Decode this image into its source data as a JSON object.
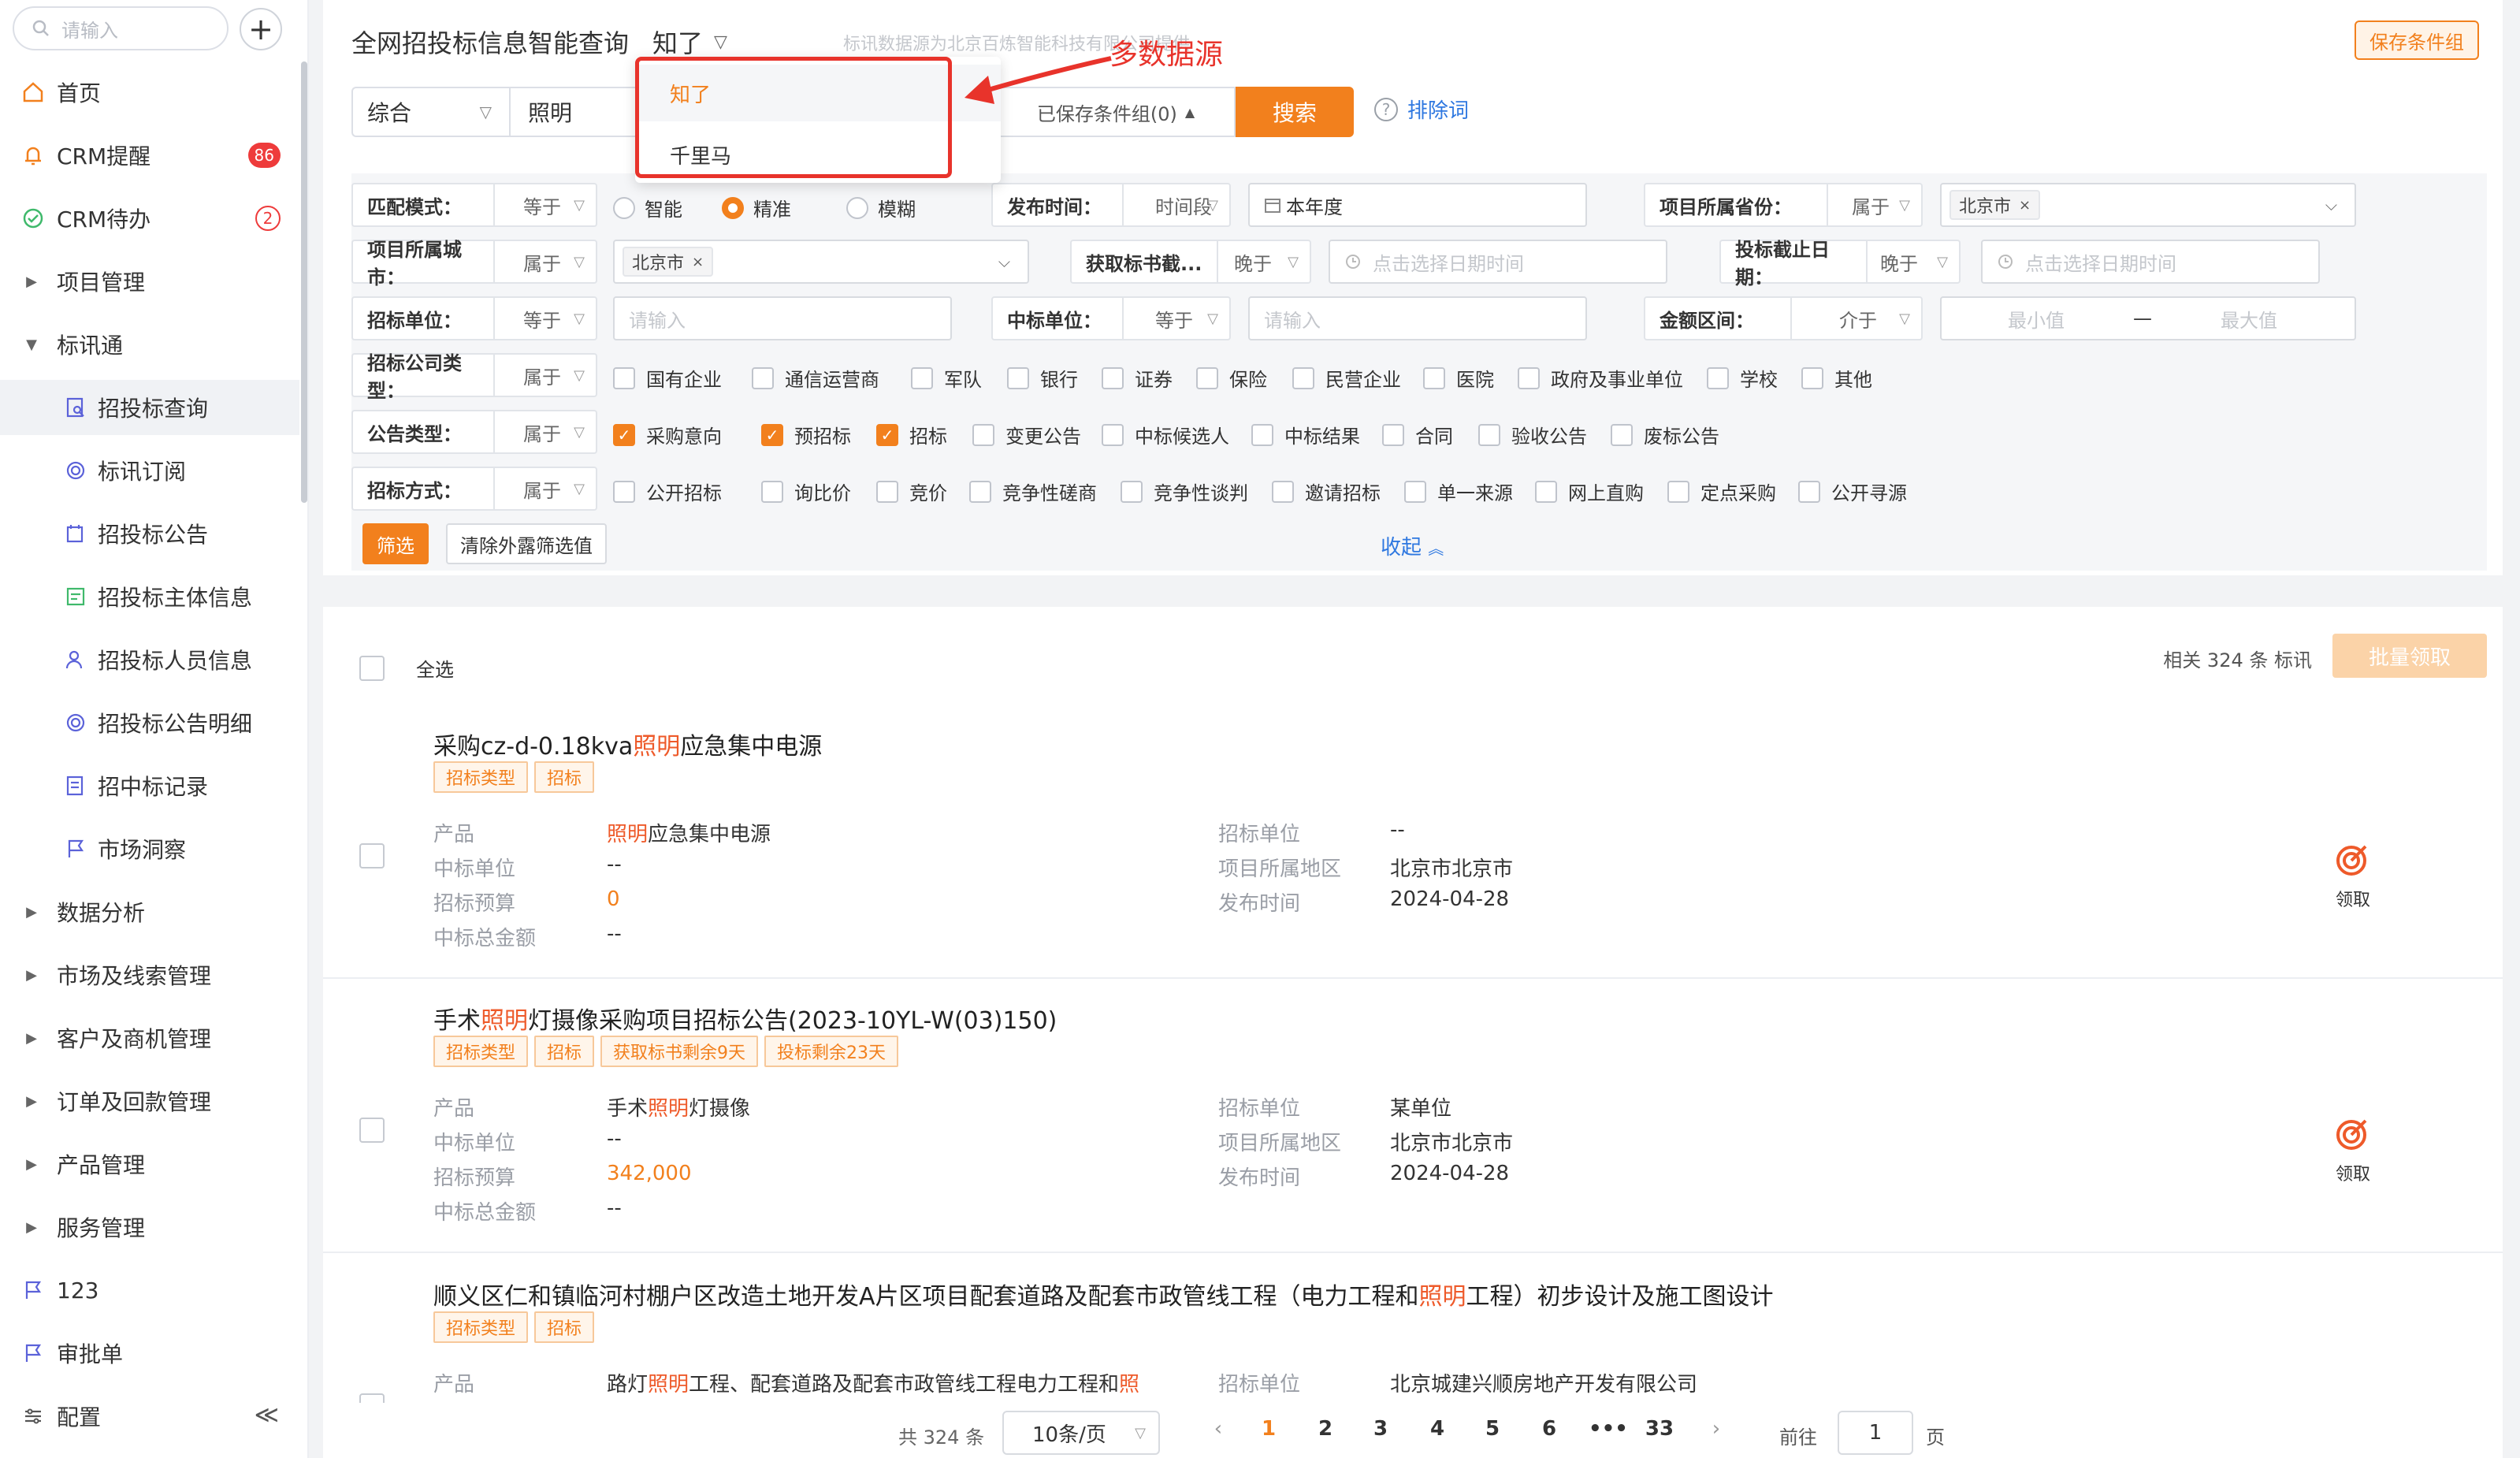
{
  "sidebar": {
    "search_placeholder": "请输入",
    "items": [
      {
        "label": "首页",
        "icon": "home-icon"
      },
      {
        "label": "CRM提醒",
        "icon": "bell-icon",
        "badge": "86"
      },
      {
        "label": "CRM待办",
        "icon": "check-circle-icon",
        "badge": "2"
      },
      {
        "label": "项目管理"
      },
      {
        "label": "标讯通"
      },
      {
        "label": "招投标查询",
        "icon": "bid-query-icon"
      },
      {
        "label": "标讯订阅",
        "icon": "subscribe-icon"
      },
      {
        "label": "招投标公告",
        "icon": "announcement-icon"
      },
      {
        "label": "招投标主体信息",
        "icon": "entity-icon"
      },
      {
        "label": "招投标人员信息",
        "icon": "person-icon"
      },
      {
        "label": "招投标公告明细",
        "icon": "detail-icon"
      },
      {
        "label": "招中标记录",
        "icon": "record-icon"
      },
      {
        "label": "市场洞察",
        "icon": "flag-icon"
      },
      {
        "label": "数据分析"
      },
      {
        "label": "市场及线索管理"
      },
      {
        "label": "客户及商机管理"
      },
      {
        "label": "订单及回款管理"
      },
      {
        "label": "产品管理"
      },
      {
        "label": "服务管理"
      },
      {
        "label": "123",
        "icon": "flag-icon"
      },
      {
        "label": "审批单",
        "icon": "flag-icon"
      },
      {
        "label": "配置",
        "icon": "sliders-icon"
      }
    ],
    "collapse_glyph": "≪"
  },
  "header": {
    "title": "全网招投标信息智能查询",
    "source_selected": "知了",
    "source_note": "标讯数据源为北京百炼智能科技有限公司提供",
    "save_group_label": "保存条件组"
  },
  "search": {
    "type": "综合",
    "value": "照明",
    "saved_groups_label": "已保存条件组(0)",
    "search_button": "搜索",
    "exclude_label": "排除词",
    "help_glyph": "?"
  },
  "dropdown": {
    "options": [
      "知了",
      "千里马"
    ]
  },
  "annotation": {
    "text": "多数据源"
  },
  "filters": {
    "match_mode": {
      "label": "匹配模式：",
      "op": "等于",
      "options": [
        "智能",
        "精准",
        "模糊"
      ],
      "selected": "精准"
    },
    "publish_time": {
      "label": "发布时间：",
      "op": "时间段",
      "value": "本年度"
    },
    "province": {
      "label": "项目所属省份：",
      "op": "属于",
      "tag": "北京市"
    },
    "city": {
      "label": "项目所属城市：",
      "op": "属于",
      "tag": "北京市"
    },
    "doc_deadline": {
      "label": "获取标书截...",
      "op": "晚于",
      "placeholder": "点击选择日期时间"
    },
    "bid_deadline": {
      "label": "投标截止日期：",
      "op": "晚于",
      "placeholder": "点击选择日期时间"
    },
    "bidder": {
      "label": "招标单位：",
      "op": "等于",
      "placeholder": "请输入"
    },
    "winner": {
      "label": "中标单位：",
      "op": "等于",
      "placeholder": "请输入"
    },
    "amount": {
      "label": "金额区间：",
      "op": "介于",
      "min_placeholder": "最小值",
      "separator": "—",
      "max_placeholder": "最大值"
    },
    "company_type": {
      "label": "招标公司类型：",
      "op": "属于",
      "options": [
        {
          "label": "国有企业",
          "checked": false
        },
        {
          "label": "通信运营商",
          "checked": false
        },
        {
          "label": "军队",
          "checked": false
        },
        {
          "label": "银行",
          "checked": false
        },
        {
          "label": "证券",
          "checked": false
        },
        {
          "label": "保险",
          "checked": false
        },
        {
          "label": "民营企业",
          "checked": false
        },
        {
          "label": "医院",
          "checked": false
        },
        {
          "label": "政府及事业单位",
          "checked": false
        },
        {
          "label": "学校",
          "checked": false
        },
        {
          "label": "其他",
          "checked": false
        }
      ]
    },
    "notice_type": {
      "label": "公告类型：",
      "op": "属于",
      "options": [
        {
          "label": "采购意向",
          "checked": true
        },
        {
          "label": "预招标",
          "checked": true
        },
        {
          "label": "招标",
          "checked": true
        },
        {
          "label": "变更公告",
          "checked": false
        },
        {
          "label": "中标候选人",
          "checked": false
        },
        {
          "label": "中标结果",
          "checked": false
        },
        {
          "label": "合同",
          "checked": false
        },
        {
          "label": "验收公告",
          "checked": false
        },
        {
          "label": "废标公告",
          "checked": false
        }
      ]
    },
    "method": {
      "label": "招标方式：",
      "op": "属于",
      "options": [
        {
          "label": "公开招标",
          "checked": false
        },
        {
          "label": "询比价",
          "checked": false
        },
        {
          "label": "竞价",
          "checked": false
        },
        {
          "label": "竞争性磋商",
          "checked": false
        },
        {
          "label": "竞争性谈判",
          "checked": false
        },
        {
          "label": "邀请招标",
          "checked": false
        },
        {
          "label": "单一来源",
          "checked": false
        },
        {
          "label": "网上直购",
          "checked": false
        },
        {
          "label": "定点采购",
          "checked": false
        },
        {
          "label": "公开寻源",
          "checked": false
        }
      ]
    },
    "apply_label": "筛选",
    "clear_label": "清除外露筛选值",
    "collapse_label": "收起"
  },
  "results": {
    "select_all_label": "全选",
    "count_text": "相关 324 条 标讯",
    "batch_claim_label": "批量领取",
    "claim_label": "领取",
    "field_labels": {
      "product": "产品",
      "winner": "中标单位",
      "budget": "招标预算",
      "total": "中标总金额",
      "bidder": "招标单位",
      "region": "项目所属地区",
      "publish": "发布时间"
    },
    "items": [
      {
        "title_pre": "采购cz-d-0.18kva",
        "title_hl": "照明",
        "title_post": "应急集中电源",
        "tags": [
          "招标类型",
          "招标"
        ],
        "product_pre": "",
        "product_hl": "照明",
        "product_post": "应急集中电源",
        "winner": "--",
        "budget": "0",
        "total": "--",
        "bidder": "--",
        "region": "北京市北京市",
        "publish": "2024-04-28"
      },
      {
        "title_pre": "手术",
        "title_hl": "照明",
        "title_post": "灯摄像采购项目招标公告(2023-10YL-W(03)150)",
        "tags": [
          "招标类型",
          "招标",
          "获取标书剩余9天",
          "投标剩余23天"
        ],
        "product_pre": "手术",
        "product_hl": "照明",
        "product_post": "灯摄像",
        "winner": "--",
        "budget": "342,000",
        "total": "--",
        "bidder": "某单位",
        "region": "北京市北京市",
        "publish": "2024-04-28"
      },
      {
        "title_pre": "顺义区仁和镇临河村棚户区改造土地开发A片区项目配套道路及配套市政管线工程（电力工程和",
        "title_hl": "照明",
        "title_post": "工程）初步设计及施工图设计",
        "tags": [
          "招标类型",
          "招标"
        ],
        "product_pre": "路灯",
        "product_hl": "照明",
        "product_post": "工程、配套道路及配套市政管线工程电力工程和",
        "product_tail_hl": "照",
        "bidder": "北京城建兴顺房地产开发有限公司"
      }
    ]
  },
  "pagination": {
    "total_text": "共 324 条",
    "page_size": "10条/页",
    "prev_glyph": "‹",
    "next_glyph": "›",
    "pages": [
      "1",
      "2",
      "3",
      "4",
      "5",
      "6",
      "•••",
      "33"
    ],
    "current": "1",
    "goto_label": "前往",
    "goto_value": "1",
    "page_label": "页"
  },
  "colors": {
    "accent": "#f2801d",
    "link": "#2f78e0",
    "badge": "#ee3b3b",
    "annotation": "#e8332b"
  }
}
